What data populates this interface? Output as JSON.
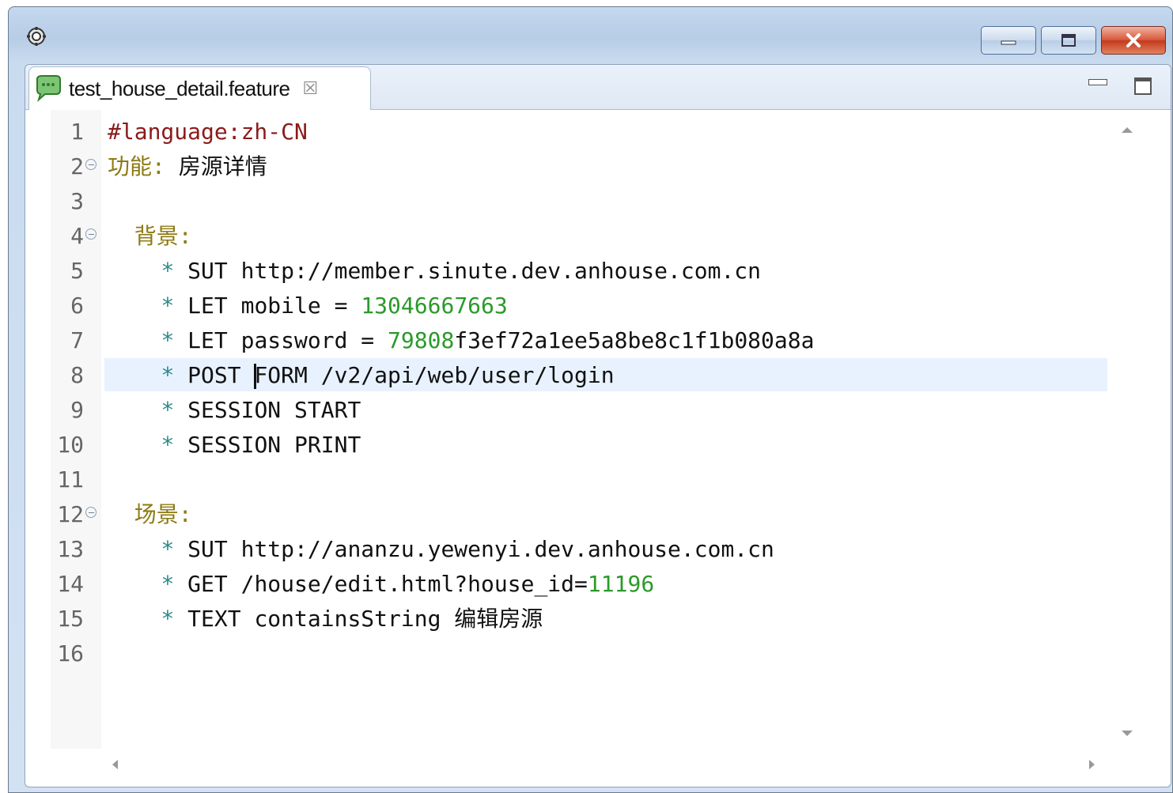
{
  "tab": {
    "title": "test_house_detail.feature",
    "close_glyph": "☒"
  },
  "editor": {
    "current_line": 8,
    "lines": [
      {
        "no": "1",
        "fold": false,
        "text": "#language:zh-CN"
      },
      {
        "no": "2",
        "fold": true,
        "text": "功能: 房源详情"
      },
      {
        "no": "3",
        "fold": false,
        "text": ""
      },
      {
        "no": "4",
        "fold": true,
        "text": "  背景:"
      },
      {
        "no": "5",
        "fold": false,
        "text": "    * SUT http://member.sinute.dev.anhouse.com.cn"
      },
      {
        "no": "6",
        "fold": false,
        "text": "    * LET mobile = 13046667663"
      },
      {
        "no": "7",
        "fold": false,
        "text": "    * LET password = 79808f3ef72a1ee5a8be8c1f1b080a8a"
      },
      {
        "no": "8",
        "fold": false,
        "text": "    * POST FORM /v2/api/web/user/login"
      },
      {
        "no": "9",
        "fold": false,
        "text": "    * SESSION START"
      },
      {
        "no": "10",
        "fold": false,
        "text": "    * SESSION PRINT"
      },
      {
        "no": "11",
        "fold": false,
        "text": ""
      },
      {
        "no": "12",
        "fold": true,
        "text": "  场景:"
      },
      {
        "no": "13",
        "fold": false,
        "text": "    * SUT http://ananzu.yewenyi.dev.anhouse.com.cn"
      },
      {
        "no": "14",
        "fold": false,
        "text": "    * GET /house/edit.html?house_id=11196"
      },
      {
        "no": "15",
        "fold": false,
        "text": "    * TEXT containsString 编辑房源"
      },
      {
        "no": "16",
        "fold": false,
        "text": ""
      }
    ]
  },
  "colors": {
    "comment": "#8a1b1b",
    "keyword": "#8d7a12",
    "step_star": "#2a8a8a",
    "number": "#2a9a2a",
    "current_line_bg": "#e8f2fe"
  },
  "icons": {
    "window_icon": "gear-icon",
    "tab_icon": "feature-bubble-icon"
  }
}
